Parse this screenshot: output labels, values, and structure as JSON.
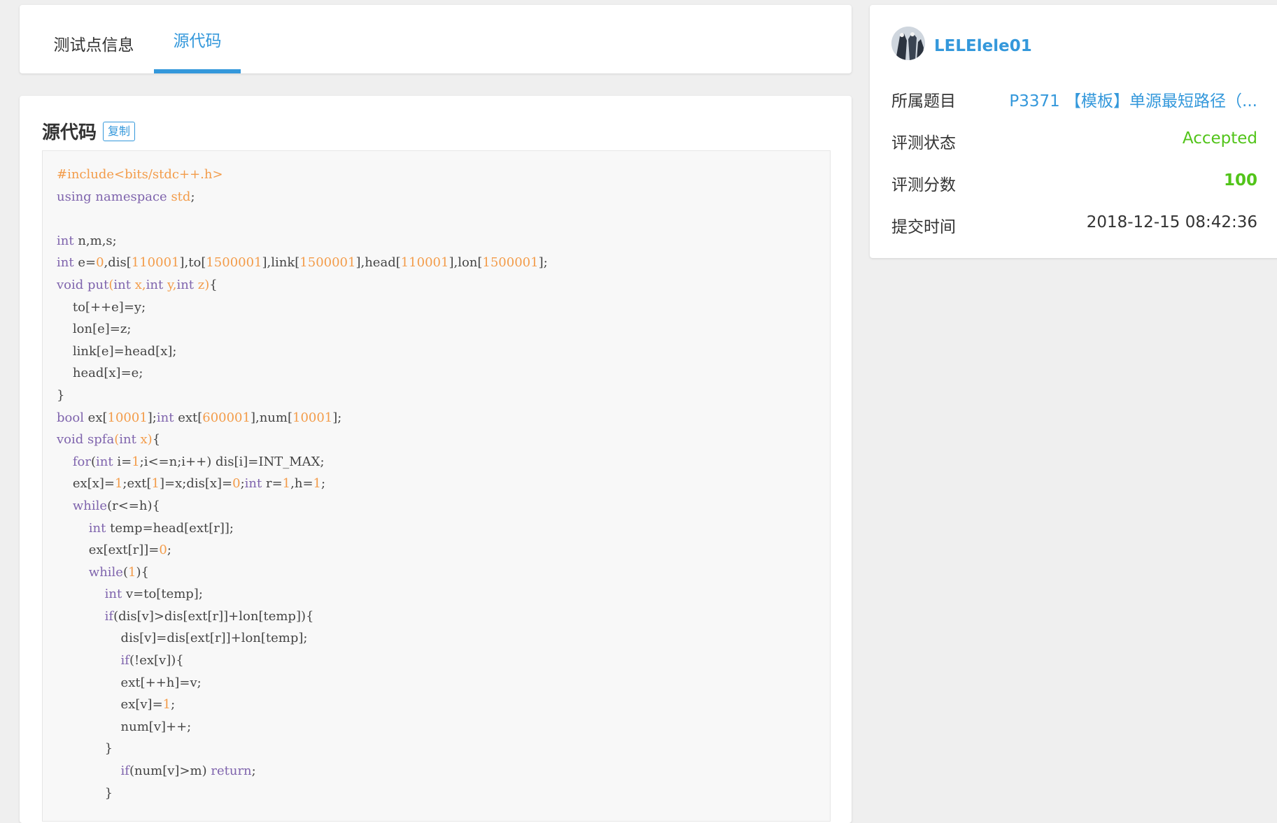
{
  "tabs": [
    {
      "label": "测试点信息",
      "active": false
    },
    {
      "label": "源代码",
      "active": true
    }
  ],
  "code_panel": {
    "title": "源代码",
    "copy_label": "复制"
  },
  "sidebar": {
    "username": "LELElele01",
    "rows": [
      {
        "label": "所属题目",
        "value": "P3371 【模板】单源最短路径（..."
      },
      {
        "label": "评测状态",
        "value": "Accepted"
      },
      {
        "label": "评测分数",
        "value": "100"
      },
      {
        "label": "提交时间",
        "value": "2018-12-15 08:42:36"
      }
    ]
  },
  "colors": {
    "accent": "#3498db",
    "success": "#52c41a",
    "keyword": "#7f64ad",
    "number": "#f39c4a"
  },
  "code": [
    [
      [
        "pre",
        "#include<bits/stdc++.h>"
      ]
    ],
    [
      [
        "kw",
        "using namespace"
      ],
      [
        "",
        " "
      ],
      [
        "num",
        "std"
      ],
      [
        "",
        ";"
      ]
    ],
    [],
    [
      [
        "kw",
        "int"
      ],
      [
        "",
        " n,m,s;"
      ]
    ],
    [
      [
        "kw",
        "int"
      ],
      [
        "",
        " e="
      ],
      [
        "num",
        "0"
      ],
      [
        "",
        ",dis["
      ],
      [
        "num",
        "110001"
      ],
      [
        "",
        "],to["
      ],
      [
        "num",
        "1500001"
      ],
      [
        "",
        "],link["
      ],
      [
        "num",
        "1500001"
      ],
      [
        "",
        "],head["
      ],
      [
        "num",
        "110001"
      ],
      [
        "",
        "],lon["
      ],
      [
        "num",
        "1500001"
      ],
      [
        "",
        "];"
      ]
    ],
    [
      [
        "kw",
        "void"
      ],
      [
        "",
        " "
      ],
      [
        "fn",
        "put"
      ],
      [
        "num",
        "("
      ],
      [
        "kw",
        "int"
      ],
      [
        "num",
        " x,"
      ],
      [
        "kw",
        "int"
      ],
      [
        "num",
        " y,"
      ],
      [
        "kw",
        "int"
      ],
      [
        "num",
        " z)"
      ],
      [
        "",
        "{"
      ]
    ],
    [
      [
        "",
        "    to[++e]=y;"
      ]
    ],
    [
      [
        "",
        "    lon[e]=z;"
      ]
    ],
    [
      [
        "",
        "    link[e]=head[x];"
      ]
    ],
    [
      [
        "",
        "    head[x]=e;"
      ]
    ],
    [
      [
        "",
        "}"
      ]
    ],
    [
      [
        "kw",
        "bool"
      ],
      [
        "",
        " ex["
      ],
      [
        "num",
        "10001"
      ],
      [
        "",
        "];"
      ],
      [
        "kw",
        "int"
      ],
      [
        "",
        " ext["
      ],
      [
        "num",
        "600001"
      ],
      [
        "",
        "],num["
      ],
      [
        "num",
        "10001"
      ],
      [
        "",
        "];"
      ]
    ],
    [
      [
        "kw",
        "void"
      ],
      [
        "",
        " "
      ],
      [
        "fn",
        "spfa"
      ],
      [
        "num",
        "("
      ],
      [
        "kw",
        "int"
      ],
      [
        "num",
        " x)"
      ],
      [
        "",
        "{"
      ]
    ],
    [
      [
        "",
        "    "
      ],
      [
        "kw",
        "for"
      ],
      [
        "",
        "("
      ],
      [
        "kw",
        "int"
      ],
      [
        "",
        " i="
      ],
      [
        "num",
        "1"
      ],
      [
        "",
        ";i<=n;i++) dis[i]=INT_MAX;"
      ]
    ],
    [
      [
        "",
        "    ex[x]="
      ],
      [
        "num",
        "1"
      ],
      [
        "",
        ";ext["
      ],
      [
        "num",
        "1"
      ],
      [
        "",
        "]=x;dis[x]="
      ],
      [
        "num",
        "0"
      ],
      [
        "",
        ";"
      ],
      [
        "kw",
        "int"
      ],
      [
        "",
        " r="
      ],
      [
        "num",
        "1"
      ],
      [
        "",
        ",h="
      ],
      [
        "num",
        "1"
      ],
      [
        "",
        ";"
      ]
    ],
    [
      [
        "",
        "    "
      ],
      [
        "kw",
        "while"
      ],
      [
        "",
        "(r<=h){"
      ]
    ],
    [
      [
        "",
        "        "
      ],
      [
        "kw",
        "int"
      ],
      [
        "",
        " temp=head[ext[r]];"
      ]
    ],
    [
      [
        "",
        "        ex[ext[r]]="
      ],
      [
        "num",
        "0"
      ],
      [
        "",
        ";"
      ]
    ],
    [
      [
        "",
        "        "
      ],
      [
        "kw",
        "while"
      ],
      [
        "",
        "("
      ],
      [
        "num",
        "1"
      ],
      [
        "",
        "){"
      ]
    ],
    [
      [
        "",
        "            "
      ],
      [
        "kw",
        "int"
      ],
      [
        "",
        " v=to[temp];"
      ]
    ],
    [
      [
        "",
        "            "
      ],
      [
        "kw",
        "if"
      ],
      [
        "",
        "(dis[v]>dis[ext[r]]+lon[temp]){"
      ]
    ],
    [
      [
        "",
        "                dis[v]=dis[ext[r]]+lon[temp];"
      ]
    ],
    [
      [
        "",
        "                "
      ],
      [
        "kw",
        "if"
      ],
      [
        "",
        "(!ex[v]){"
      ]
    ],
    [
      [
        "",
        "                ext[++h]=v;"
      ]
    ],
    [
      [
        "",
        "                ex[v]="
      ],
      [
        "num",
        "1"
      ],
      [
        "",
        ";"
      ]
    ],
    [
      [
        "",
        "                num[v]++;"
      ]
    ],
    [
      [
        "",
        "            }"
      ]
    ],
    [
      [
        "",
        "                "
      ],
      [
        "kw",
        "if"
      ],
      [
        "",
        "(num[v]>m) "
      ],
      [
        "kw",
        "return"
      ],
      [
        "",
        ";"
      ]
    ],
    [
      [
        "",
        "            }"
      ]
    ]
  ]
}
